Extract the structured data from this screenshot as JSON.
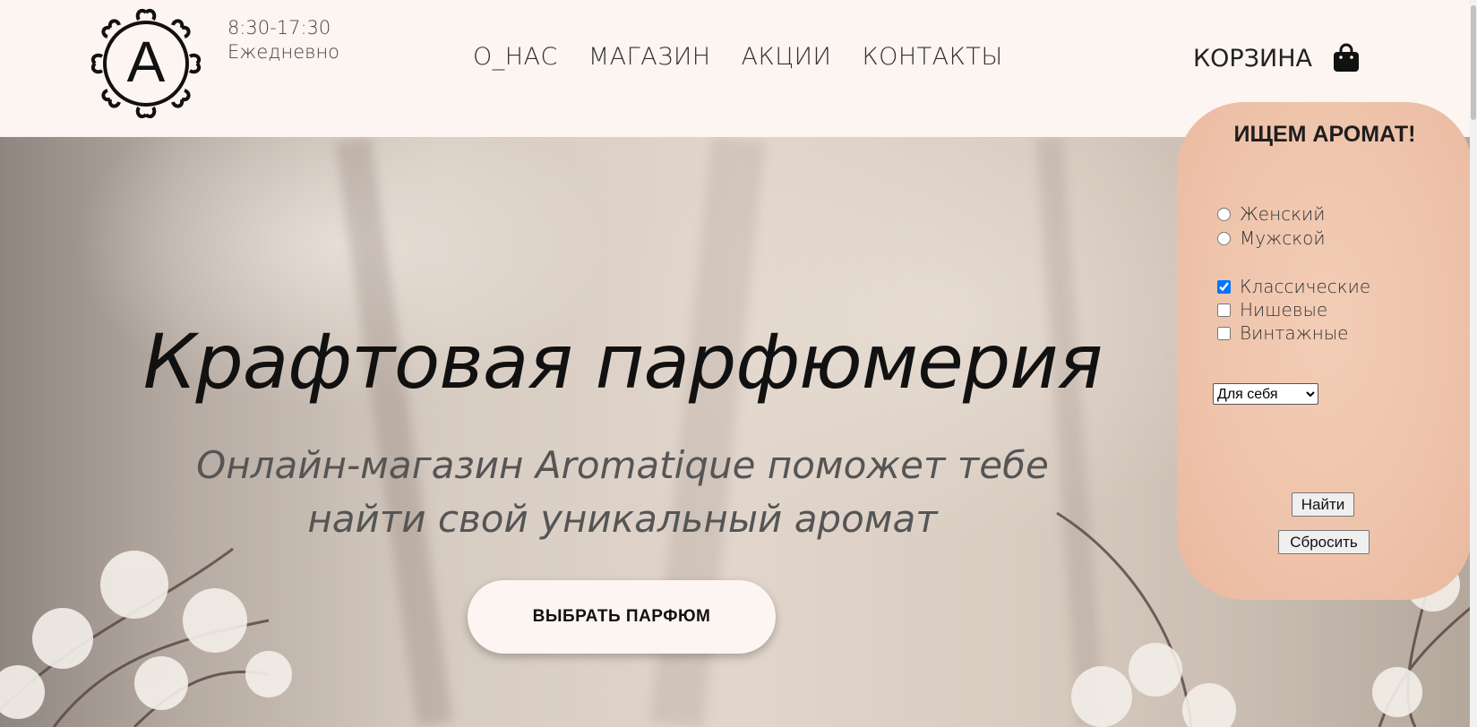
{
  "header": {
    "hours": "8:30-17:30",
    "days": "Ежедневно",
    "nav": [
      "О_НАС",
      "МАГАЗИН",
      "АКЦИИ",
      "КОНТАКТЫ"
    ],
    "cart_label": "КОРЗИНА",
    "logo_letter": "A"
  },
  "hero": {
    "title": "Крафтовая парфюмерия",
    "subtitle_line1": "Онлайн-магазин Aromatique поможет тебе",
    "subtitle_line2": "найти свой уникальный аромат",
    "cta_label": "ВЫБРАТЬ ПАРФЮМ"
  },
  "search_panel": {
    "title": "ИЩЕМ АРОМАТ!",
    "gender_options": [
      {
        "label": "Женский",
        "checked": false
      },
      {
        "label": "Мужской",
        "checked": false
      }
    ],
    "type_options": [
      {
        "label": "Классические",
        "checked": true
      },
      {
        "label": "Нишевые",
        "checked": false
      },
      {
        "label": "Винтажные",
        "checked": false
      }
    ],
    "select_value": "Для себя",
    "find_label": "Найти",
    "reset_label": "Сбросить"
  },
  "colors": {
    "header_bg": "#fdf5f1",
    "panel_bg": "#eec3aa",
    "checkbox_accent": "#1a6fe0"
  },
  "icons": [
    "logo-emblem",
    "shopping-bag-icon",
    "chevron-down-icon"
  ]
}
